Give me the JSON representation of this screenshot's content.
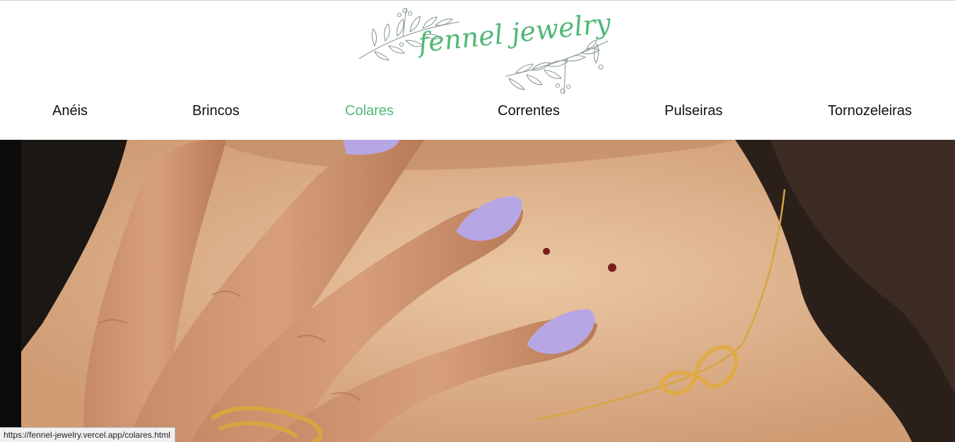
{
  "brand": {
    "logo_text": "fennel jewelry"
  },
  "nav": {
    "items": [
      {
        "label": "Anéis",
        "active": false
      },
      {
        "label": "Brincos",
        "active": false
      },
      {
        "label": "Colares",
        "active": true
      },
      {
        "label": "Correntes",
        "active": false
      },
      {
        "label": "Pulseiras",
        "active": false
      },
      {
        "label": "Tornozeleiras",
        "active": false
      }
    ]
  },
  "hero": {
    "alt": "Colar dourado com pingente de infinito"
  },
  "status_bar": {
    "url": "https://fennel-jewelry.vercel.app/colares.html"
  },
  "colors": {
    "accent": "#4fb878",
    "nav_text": "#111111",
    "nail": "#b7a6e4",
    "gold": "#d9a441"
  }
}
